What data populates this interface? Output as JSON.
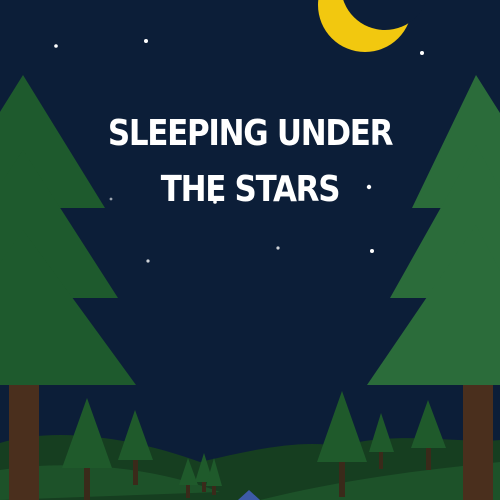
{
  "poster": {
    "title_line1": "SLEEPING UNDER",
    "title_line2": "THE STARS"
  },
  "colors": {
    "sky": "#0c1e38",
    "moon": "#f2c80f",
    "tree_dark": "#1e5a2d",
    "tree_light": "#2b6c3a",
    "trunk": "#4a2f1d",
    "hill": "#1a4a24",
    "tent": "#3d5aa8"
  }
}
